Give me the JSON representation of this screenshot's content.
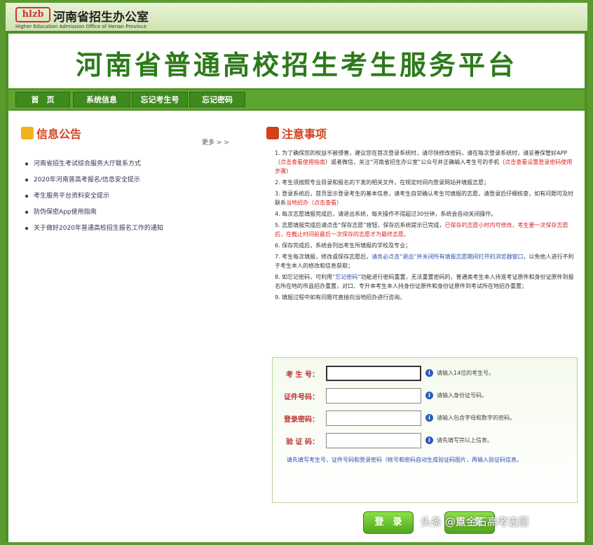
{
  "header": {
    "logo_text": "hlzb",
    "org_name": "河南省招生办公室",
    "org_name_en": "Higher Education Admission Office of Henan Province"
  },
  "banner": {
    "title": "河南省普通高校招生考生服务平台"
  },
  "nav": {
    "items": [
      {
        "label": "首　页"
      },
      {
        "label": "系统信息"
      },
      {
        "label": "忘记考生号"
      },
      {
        "label": "忘记密码"
      }
    ]
  },
  "news": {
    "title": "信息公告",
    "more": "更多 > >",
    "items": [
      {
        "label": "河南省招生考试综合服务大厅联系方式"
      },
      {
        "label": "2020年河南普高考报名/信息安全提示"
      },
      {
        "label": "考生服务平台资料安全提示"
      },
      {
        "label": "防伪保密App使用指南"
      },
      {
        "label": "关于做好2020年普通高校招生报名工作的通知"
      }
    ]
  },
  "notice": {
    "title": "注意事项",
    "items": [
      {
        "text": "1. 为了确保您的权益不被侵害，建议您在首次登录系统时，请尽快修改密码，请在每次登录系统时，请妥善保管好APP（",
        "red": "点击查看使用指南",
        "tail": "）或者微信，关注“河南省招生办公室”公众号并正确输入考生号的手机（",
        "red2": "点击查看设置登录密码使用步骤",
        "tail2": "）"
      },
      {
        "text": "2. 考生须按照专业目录和报名的下发的相关文件，在规定时间内登录网站并填报志愿；"
      },
      {
        "text": "3. 登录系统后，首页显示登录考生的基本信息，请考生自觉确认考生可填报的志愿，请登录后仔细核查，如有问题可及时联系",
        "red": "当地招办（点击查看）"
      },
      {
        "text": "4. 每次志愿填报完成后，请退出系统，每天操作不得超过30分钟，系统会自动关闭操作。"
      },
      {
        "text": "5. 志愿填报完成后请点击“保存志愿”按钮，保存后系统提示已完成，",
        "red": "已保存的志愿小时内可修改，考生要一次保存志愿后，在截止时间前最后一次保存的志愿才为最终志愿。"
      },
      {
        "text": "6. 保存完成后，系统会列出考生所填报的学校及专业；"
      },
      {
        "text": "7. 考生每次填报，修改或保存志愿后，",
        "blue": "请务必点击“退出”并关闭所有填报志愿期间打开的浏览器窗口",
        "tail": "，以免他人进行不利于考生本人的修改和信息获取；"
      },
      {
        "text": "8. 如忘记密码，可利用",
        "blue": "“忘记密码”",
        "tail": "功能进行密码重置，无法重置密码的，普通类考生本人持准考证原件和身份证原件到报名所在地的市县招办重置，对口、专升本考生本人持身份证原件和身份证原件到考试所在地招办重置；"
      },
      {
        "text": "9. 填报过程中如有问题可直接向当地招办进行咨询。"
      }
    ]
  },
  "login": {
    "rows": [
      {
        "label": "考 生 号：",
        "hint": "请输入14位的考生号。",
        "value": ""
      },
      {
        "label": "证件号码：",
        "hint": "请输入身份证号码。",
        "value": ""
      },
      {
        "label": "登录密码：",
        "hint": "请输入包含字母和数字的密码。",
        "value": ""
      },
      {
        "label": "验 证 码：",
        "hint": "请先填写完以上信息。",
        "value": ""
      }
    ],
    "footer_note": "请先填写考生号、证件号码和登录密码（帐号和密码自动生成验证码图片，再输入验证码信息。",
    "login_button": "登　录",
    "reset_button": "重　置"
  },
  "watermark": "头条 @点金石高考志愿",
  "colors": {
    "primary_green": "#4f8f26",
    "title_green": "#2d7a1a",
    "accent_red": "#d2421a"
  }
}
